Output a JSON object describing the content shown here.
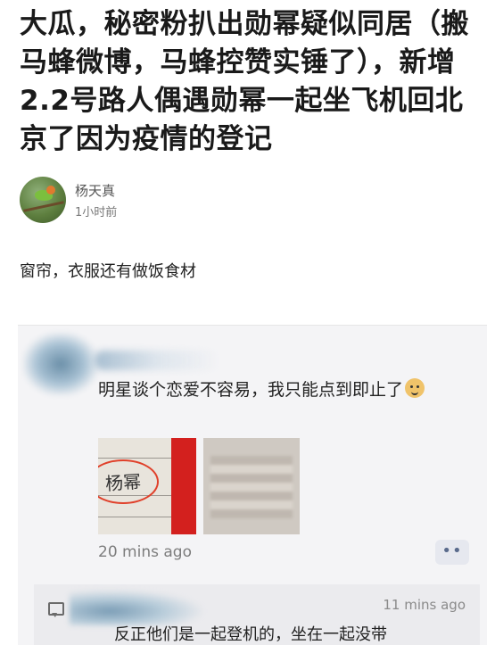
{
  "headline": "大瓜，秘密粉扒出勋幂疑似同居（搬马蜂微博，马蜂控赞实锤了），新增2.2号路人偶遇勋幂一起坐飞机回北京了因为疫情的登记",
  "author": {
    "name": "杨天真",
    "time": "1小时前"
  },
  "post_text": "窗帘，衣服还有做饭食材",
  "screenshot": {
    "comment_text": "明星谈个恋爱不容易，我只能点到即止了",
    "emoji_icon": "doge-emoji",
    "photo1_handwriting": "杨幂",
    "time": "20 mins ago",
    "more_label": "••",
    "reply": {
      "time": "11 mins ago",
      "text": "反正他们是一起登机的，坐在一起没带"
    }
  }
}
